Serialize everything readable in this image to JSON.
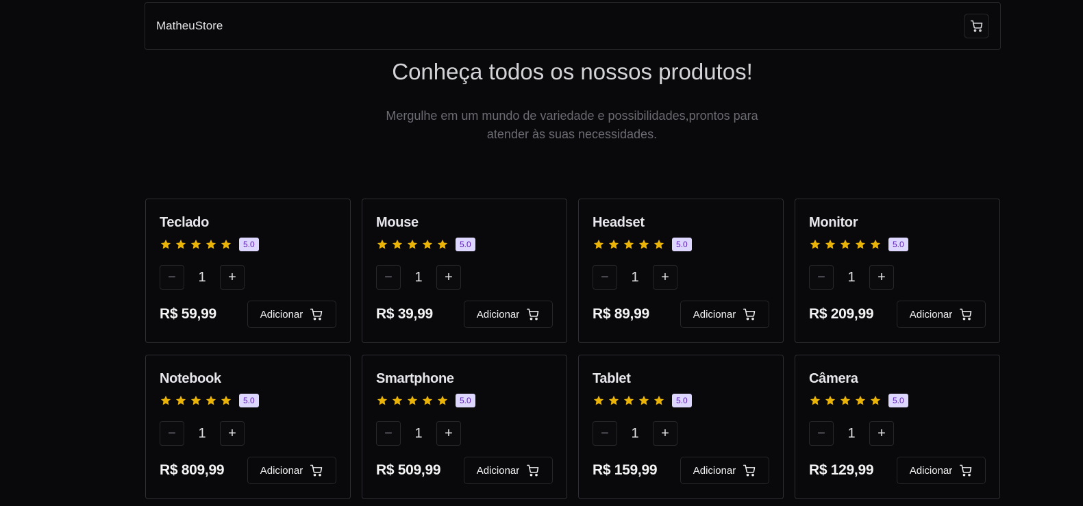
{
  "header": {
    "brand": "MatheuStore",
    "cart_icon": "shopping-cart-icon"
  },
  "hero": {
    "title": "Conheça todos os nossos produtos!",
    "subtitle": "Mergulhe em um mundo de variedade e possibilidades,prontos para atender às suas necessidades."
  },
  "colors": {
    "background": "#09090b",
    "star": "#eab308",
    "badge_bg": "#ddd6fe",
    "badge_text": "#5b21b6"
  },
  "products": [
    {
      "name": "Teclado",
      "rating": "5.0",
      "stars": 5,
      "qty": "1",
      "price": "R$ 59,99",
      "button": "Adicionar"
    },
    {
      "name": "Mouse",
      "rating": "5.0",
      "stars": 5,
      "qty": "1",
      "price": "R$ 39,99",
      "button": "Adicionar"
    },
    {
      "name": "Headset",
      "rating": "5.0",
      "stars": 5,
      "qty": "1",
      "price": "R$ 89,99",
      "button": "Adicionar"
    },
    {
      "name": "Monitor",
      "rating": "5.0",
      "stars": 5,
      "qty": "1",
      "price": "R$ 209,99",
      "button": "Adicionar"
    },
    {
      "name": "Notebook",
      "rating": "5.0",
      "stars": 5,
      "qty": "1",
      "price": "R$ 809,99",
      "button": "Adicionar"
    },
    {
      "name": "Smartphone",
      "rating": "5.0",
      "stars": 5,
      "qty": "1",
      "price": "R$ 509,99",
      "button": "Adicionar"
    },
    {
      "name": "Tablet",
      "rating": "5.0",
      "stars": 5,
      "qty": "1",
      "price": "R$ 159,99",
      "button": "Adicionar"
    },
    {
      "name": "Câmera",
      "rating": "5.0",
      "stars": 5,
      "qty": "1",
      "price": "R$ 129,99",
      "button": "Adicionar"
    }
  ],
  "qty_controls": {
    "minus": "−",
    "plus": "+"
  }
}
